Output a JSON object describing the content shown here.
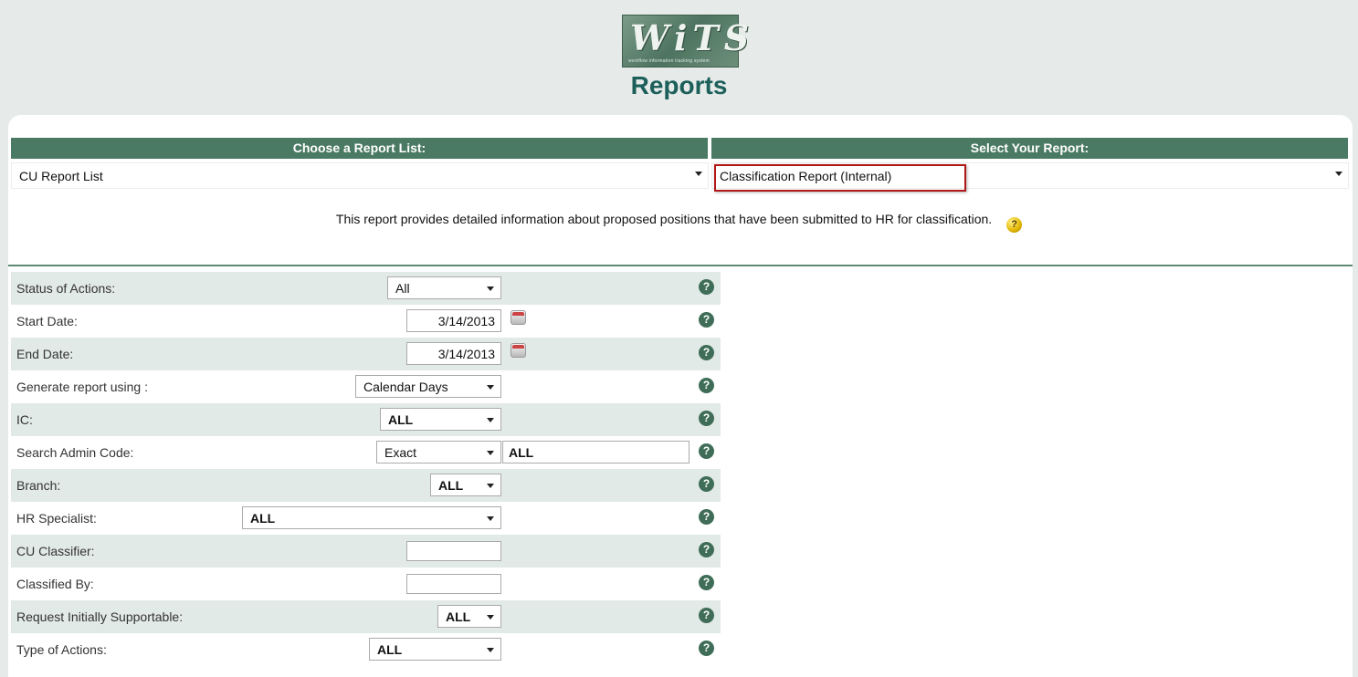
{
  "logo": {
    "text": "WiTS",
    "subtitle": "workflow information tracking system"
  },
  "page_title": "Reports",
  "report_list": {
    "header": "Choose a Report List:",
    "selected": "CU Report List"
  },
  "report_select": {
    "header": "Select Your Report:",
    "selected": "Classification Report (Internal)"
  },
  "description": "This report provides detailed information about proposed positions that have been submitted to HR for classification.",
  "help_glyph": "?",
  "form": {
    "status_of_actions": {
      "label": "Status of Actions:",
      "value": "All"
    },
    "start_date": {
      "label": "Start Date:",
      "value": "3/14/2013"
    },
    "end_date": {
      "label": "End Date:",
      "value": "3/14/2013"
    },
    "generate_using": {
      "label": "Generate report using :",
      "value": "Calendar Days"
    },
    "ic": {
      "label": "IC:",
      "value": "ALL"
    },
    "search_admin_code": {
      "label": "Search Admin Code:",
      "match": "Exact",
      "value": "ALL"
    },
    "branch": {
      "label": "Branch:",
      "value": "ALL"
    },
    "hr_specialist": {
      "label": "HR Specialist:",
      "value": "ALL"
    },
    "cu_classifier": {
      "label": "CU Classifier:",
      "value": ""
    },
    "classified_by": {
      "label": "Classified By:",
      "value": ""
    },
    "request_initially_supportable": {
      "label": "Request Initially Supportable:",
      "value": "ALL"
    },
    "type_of_actions": {
      "label": "Type of Actions:",
      "value": "ALL"
    }
  },
  "colors": {
    "header_green": "#4a7a63",
    "title_teal": "#1d5f5b",
    "row_shade": "#e2eae7",
    "highlight": "#b01717"
  }
}
